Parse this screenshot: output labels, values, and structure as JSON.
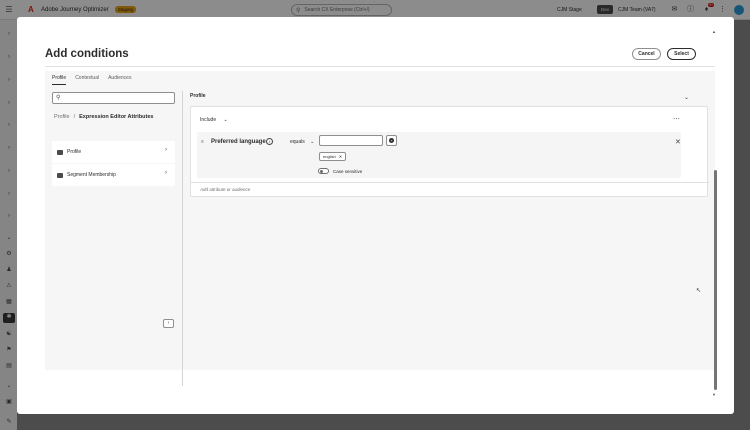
{
  "topbar": {
    "app_name": "Adobe Journey Optimizer",
    "badge": "Staging",
    "search_placeholder": "Search CX Enterprise (Ctrl+/)",
    "org": "CJM Stage",
    "env": "Dev",
    "team": "CJM Team (VA7)",
    "notification_count": "9+"
  },
  "dialog": {
    "title": "Add conditions",
    "cancel_label": "Cancel",
    "select_label": "Select"
  },
  "left_panel": {
    "tabs": [
      "Profile",
      "Contextual",
      "Audiences"
    ],
    "active_tab": "Profile",
    "breadcrumb": {
      "root": "Profile",
      "separator": "/",
      "current": "Expression Editor Attributes"
    },
    "tree_items": [
      "Profile",
      "Segment Membership"
    ]
  },
  "right_panel": {
    "title": "Profile",
    "include_label": "Include",
    "condition": {
      "attribute": "Preferred language",
      "operator": "equals",
      "value_tag": "english",
      "case_sensitive_label": "Case sensitive",
      "case_sensitive": false
    },
    "add_attribute_placeholder": "Add attribute or audience"
  },
  "colors": {
    "brand_red": "#e1251b",
    "badge_orange": "#e8a317",
    "notification_red": "#d31510",
    "avatar_blue": "#2b9cd8"
  }
}
